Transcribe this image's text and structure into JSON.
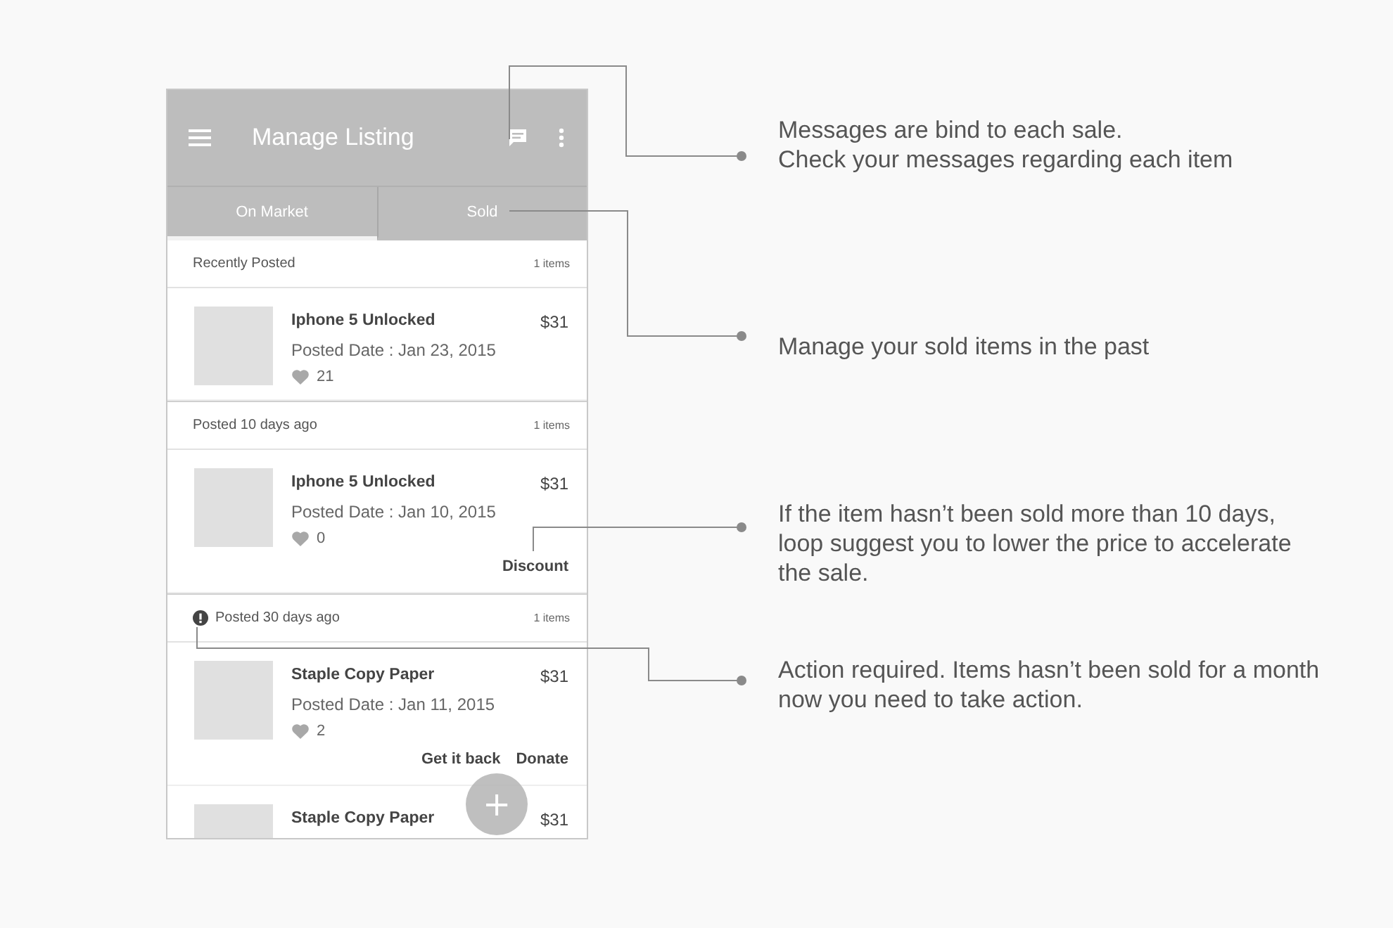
{
  "app_bar": {
    "title": "Manage Listing"
  },
  "tabs": [
    {
      "label": "On Market",
      "selected": true
    },
    {
      "label": "Sold",
      "selected": false
    }
  ],
  "sections": [
    {
      "title": "Recently Posted",
      "count": "1 items",
      "alert": false,
      "items": [
        {
          "name": "Iphone 5 Unlocked",
          "price": "$31",
          "date": "Posted Date : Jan 23, 2015",
          "likes": "21"
        }
      ]
    },
    {
      "title": "Posted 10 days ago",
      "count": "1 items",
      "alert": false,
      "items": [
        {
          "name": "Iphone 5 Unlocked",
          "price": "$31",
          "date": "Posted Date : Jan 10, 2015",
          "likes": "0",
          "actions": [
            "Discount"
          ]
        }
      ]
    },
    {
      "title": "Posted 30 days ago",
      "count": "1 items",
      "alert": true,
      "items": [
        {
          "name": "Staple Copy Paper",
          "price": "$31",
          "date": "Posted Date : Jan 11, 2015",
          "likes": "2",
          "actions": [
            "Get it back",
            "Donate"
          ]
        },
        {
          "name": "Staple Copy Paper",
          "price": "$31"
        }
      ]
    }
  ],
  "fab": {
    "label": "+"
  },
  "annotations": [
    {
      "text": "Messages are bind to each sale.\nCheck your messages regarding each item"
    },
    {
      "text": "Manage your sold items in the past"
    },
    {
      "text": "If the item hasn’t been sold more than 10 days,\nloop suggest you to lower the price to accelerate\nthe sale."
    },
    {
      "text": "Action required. Items hasn’t been sold for a month\nnow you need to take action."
    }
  ]
}
